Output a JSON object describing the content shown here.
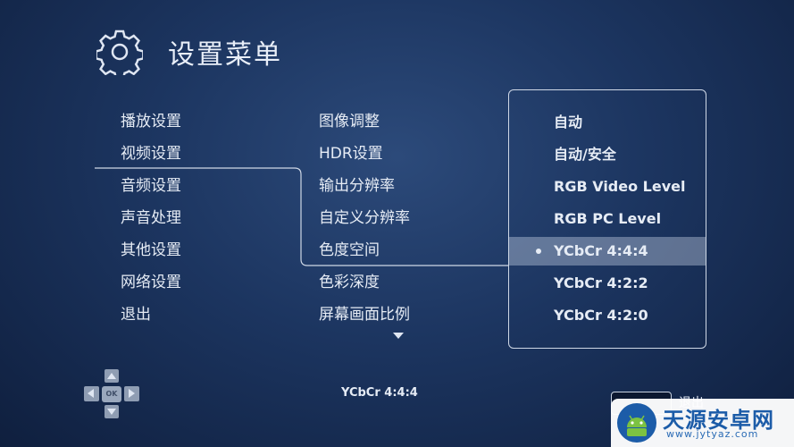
{
  "header": {
    "title": "设置菜单",
    "icon": "gear-icon"
  },
  "menu_left": [
    {
      "label": "播放设置"
    },
    {
      "label": "视频设置",
      "active": true
    },
    {
      "label": "音频设置"
    },
    {
      "label": "声音处理"
    },
    {
      "label": "其他设置"
    },
    {
      "label": "网络设置"
    },
    {
      "label": "退出"
    }
  ],
  "menu_middle": [
    {
      "label": "图像调整"
    },
    {
      "label": "HDR设置"
    },
    {
      "label": "输出分辨率"
    },
    {
      "label": "自定义分辨率"
    },
    {
      "label": "色度空间",
      "active": true
    },
    {
      "label": "色彩深度"
    },
    {
      "label": "屏幕画面比例"
    }
  ],
  "options": [
    {
      "label": "自动"
    },
    {
      "label": "自动/安全"
    },
    {
      "label": "RGB Video Level"
    },
    {
      "label": "RGB PC Level"
    },
    {
      "label": "YCbCr 4:4:4",
      "selected": true
    },
    {
      "label": "YCbCr 4:2:2"
    },
    {
      "label": "YCbCr 4:2:0"
    }
  ],
  "status": {
    "current_value": "YCbCr 4:4:4"
  },
  "remote_hint": {
    "ok_label": "OK"
  },
  "footer": {
    "exit_label": "退出"
  },
  "watermark": {
    "title": "天源安卓网",
    "url": "www.jytyaz.com"
  },
  "colors": {
    "background": "#1c3560",
    "highlight": "#5f7698",
    "text": "#e6ecf5",
    "watermark_blue": "#1c5ca8"
  }
}
